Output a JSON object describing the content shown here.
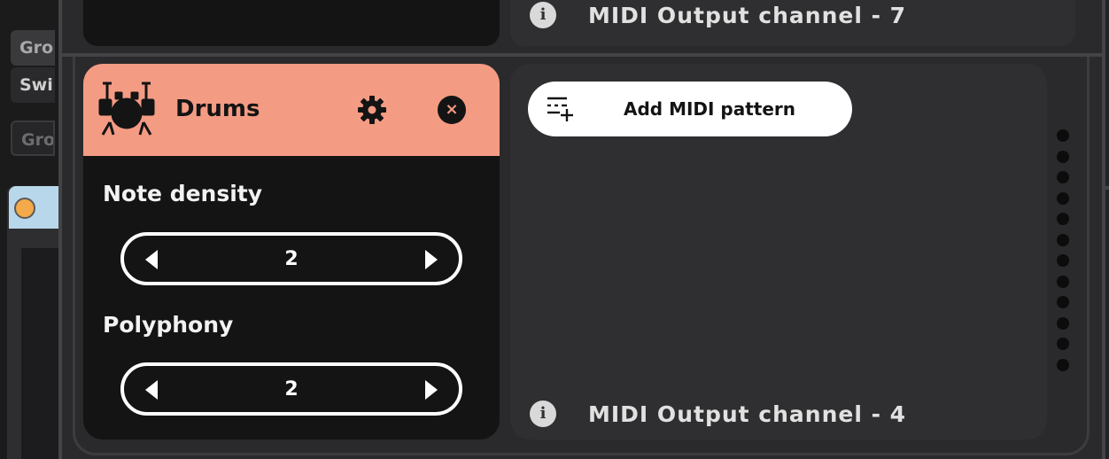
{
  "sidebar": {
    "chips": [
      {
        "label": "Gro"
      },
      {
        "label": "Swi"
      },
      {
        "label": "Gro"
      }
    ],
    "knob_color": "#f4a94a",
    "header_color": "#b9d7ea"
  },
  "previous_row": {
    "output_channel_label": "MIDI Output channel - 7"
  },
  "track": {
    "name": "Drums",
    "header_color": "#f49b84",
    "icon": "drum-kit-icon",
    "settings_icon": "gear-icon",
    "close_icon": "close-icon",
    "close_glyph": "×",
    "params": [
      {
        "label": "Note density",
        "value": "2"
      },
      {
        "label": "Polyphony",
        "value": "2"
      }
    ]
  },
  "pattern": {
    "add_label": "Add MIDI pattern",
    "add_icon": "add-list-icon",
    "info_glyph": "i",
    "output_channel_label": "MIDI Output channel - 4"
  },
  "scroll_dots": 12
}
